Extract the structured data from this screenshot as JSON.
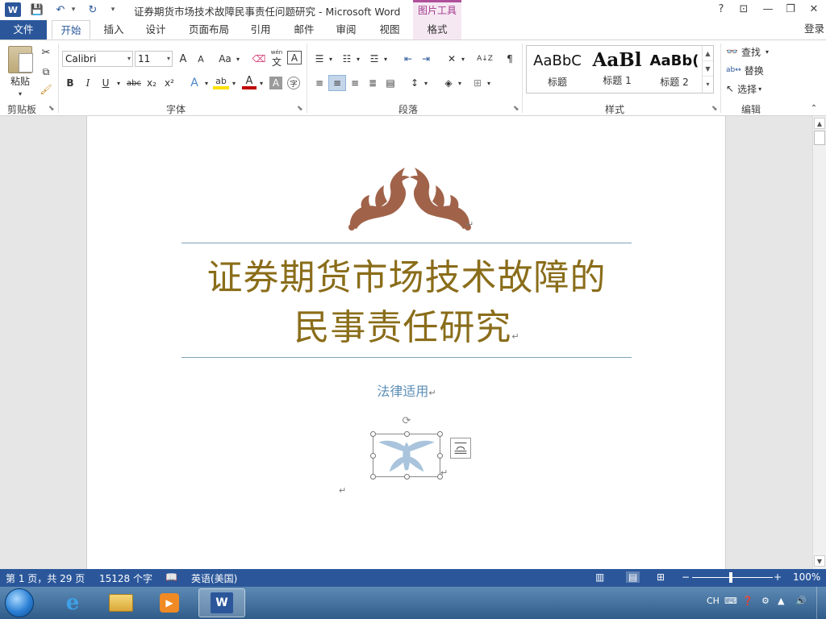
{
  "window": {
    "title": "证券期货市场技术故障民事责任问题研究 - Microsoft Word",
    "contextual_tab_label": "图片工具",
    "login_label": "登录",
    "help_label": "?",
    "controls": {
      "ribbon_options": "⊡",
      "minimize": "—",
      "restore": "❐",
      "close": "✕"
    }
  },
  "quick_access": {
    "save_icon": "💾",
    "undo_icon": "↶",
    "redo_icon": "↻",
    "customize_icon": "▾"
  },
  "ribbon_tabs": {
    "file": "文件",
    "home": "开始",
    "insert": "插入",
    "design": "设计",
    "page_layout": "页面布局",
    "references": "引用",
    "mailings": "邮件",
    "review": "审阅",
    "view": "视图",
    "format": "格式"
  },
  "clipboard": {
    "paste_label": "粘贴",
    "group_label": "剪贴板"
  },
  "font": {
    "font_name": "Calibri",
    "font_size": "11",
    "group_label": "字体",
    "grow": "A",
    "shrink": "A",
    "case": "Aa",
    "bold": "B",
    "italic": "I",
    "underline": "U",
    "strike": "abc",
    "subscript": "x₂",
    "superscript": "x²",
    "border_char": "A",
    "text_color": "A",
    "shade_char": "A",
    "phonetic_pinyin": "wén",
    "phonetic_char": "文",
    "enclose_char": "字"
  },
  "paragraph": {
    "group_label": "段落",
    "sort_label": "A↓Z"
  },
  "styles": {
    "group_label": "样式",
    "items": [
      {
        "preview": "AaBbC",
        "name": "标题"
      },
      {
        "preview": "AaBl",
        "name": "标题 1"
      },
      {
        "preview": "AaBb(",
        "name": "标题 2"
      }
    ]
  },
  "editing": {
    "find": "查找",
    "replace": "替换",
    "select": "选择",
    "group_label": "编辑"
  },
  "document": {
    "title_line1": "证券期货市场技术故障的",
    "title_line2": "民事责任研究",
    "subtitle": "法律适用",
    "paragraph_mark": "↵"
  },
  "status": {
    "page_info": "第 1 页，共 29 页",
    "word_count": "15128 个字",
    "language": "英语(美国)",
    "zoom": "100%",
    "zoom_minus": "−",
    "zoom_plus": "+"
  },
  "taskbar": {
    "input_method": "CH"
  },
  "colors": {
    "word_blue": "#2b579a",
    "title_gold": "#8a6d1a",
    "subtitle_blue": "#5b8db5",
    "ornament_brown": "#a0634a",
    "figure_blue": "#a9c4dc",
    "pic_tools_pink": "#f6e8f3"
  }
}
